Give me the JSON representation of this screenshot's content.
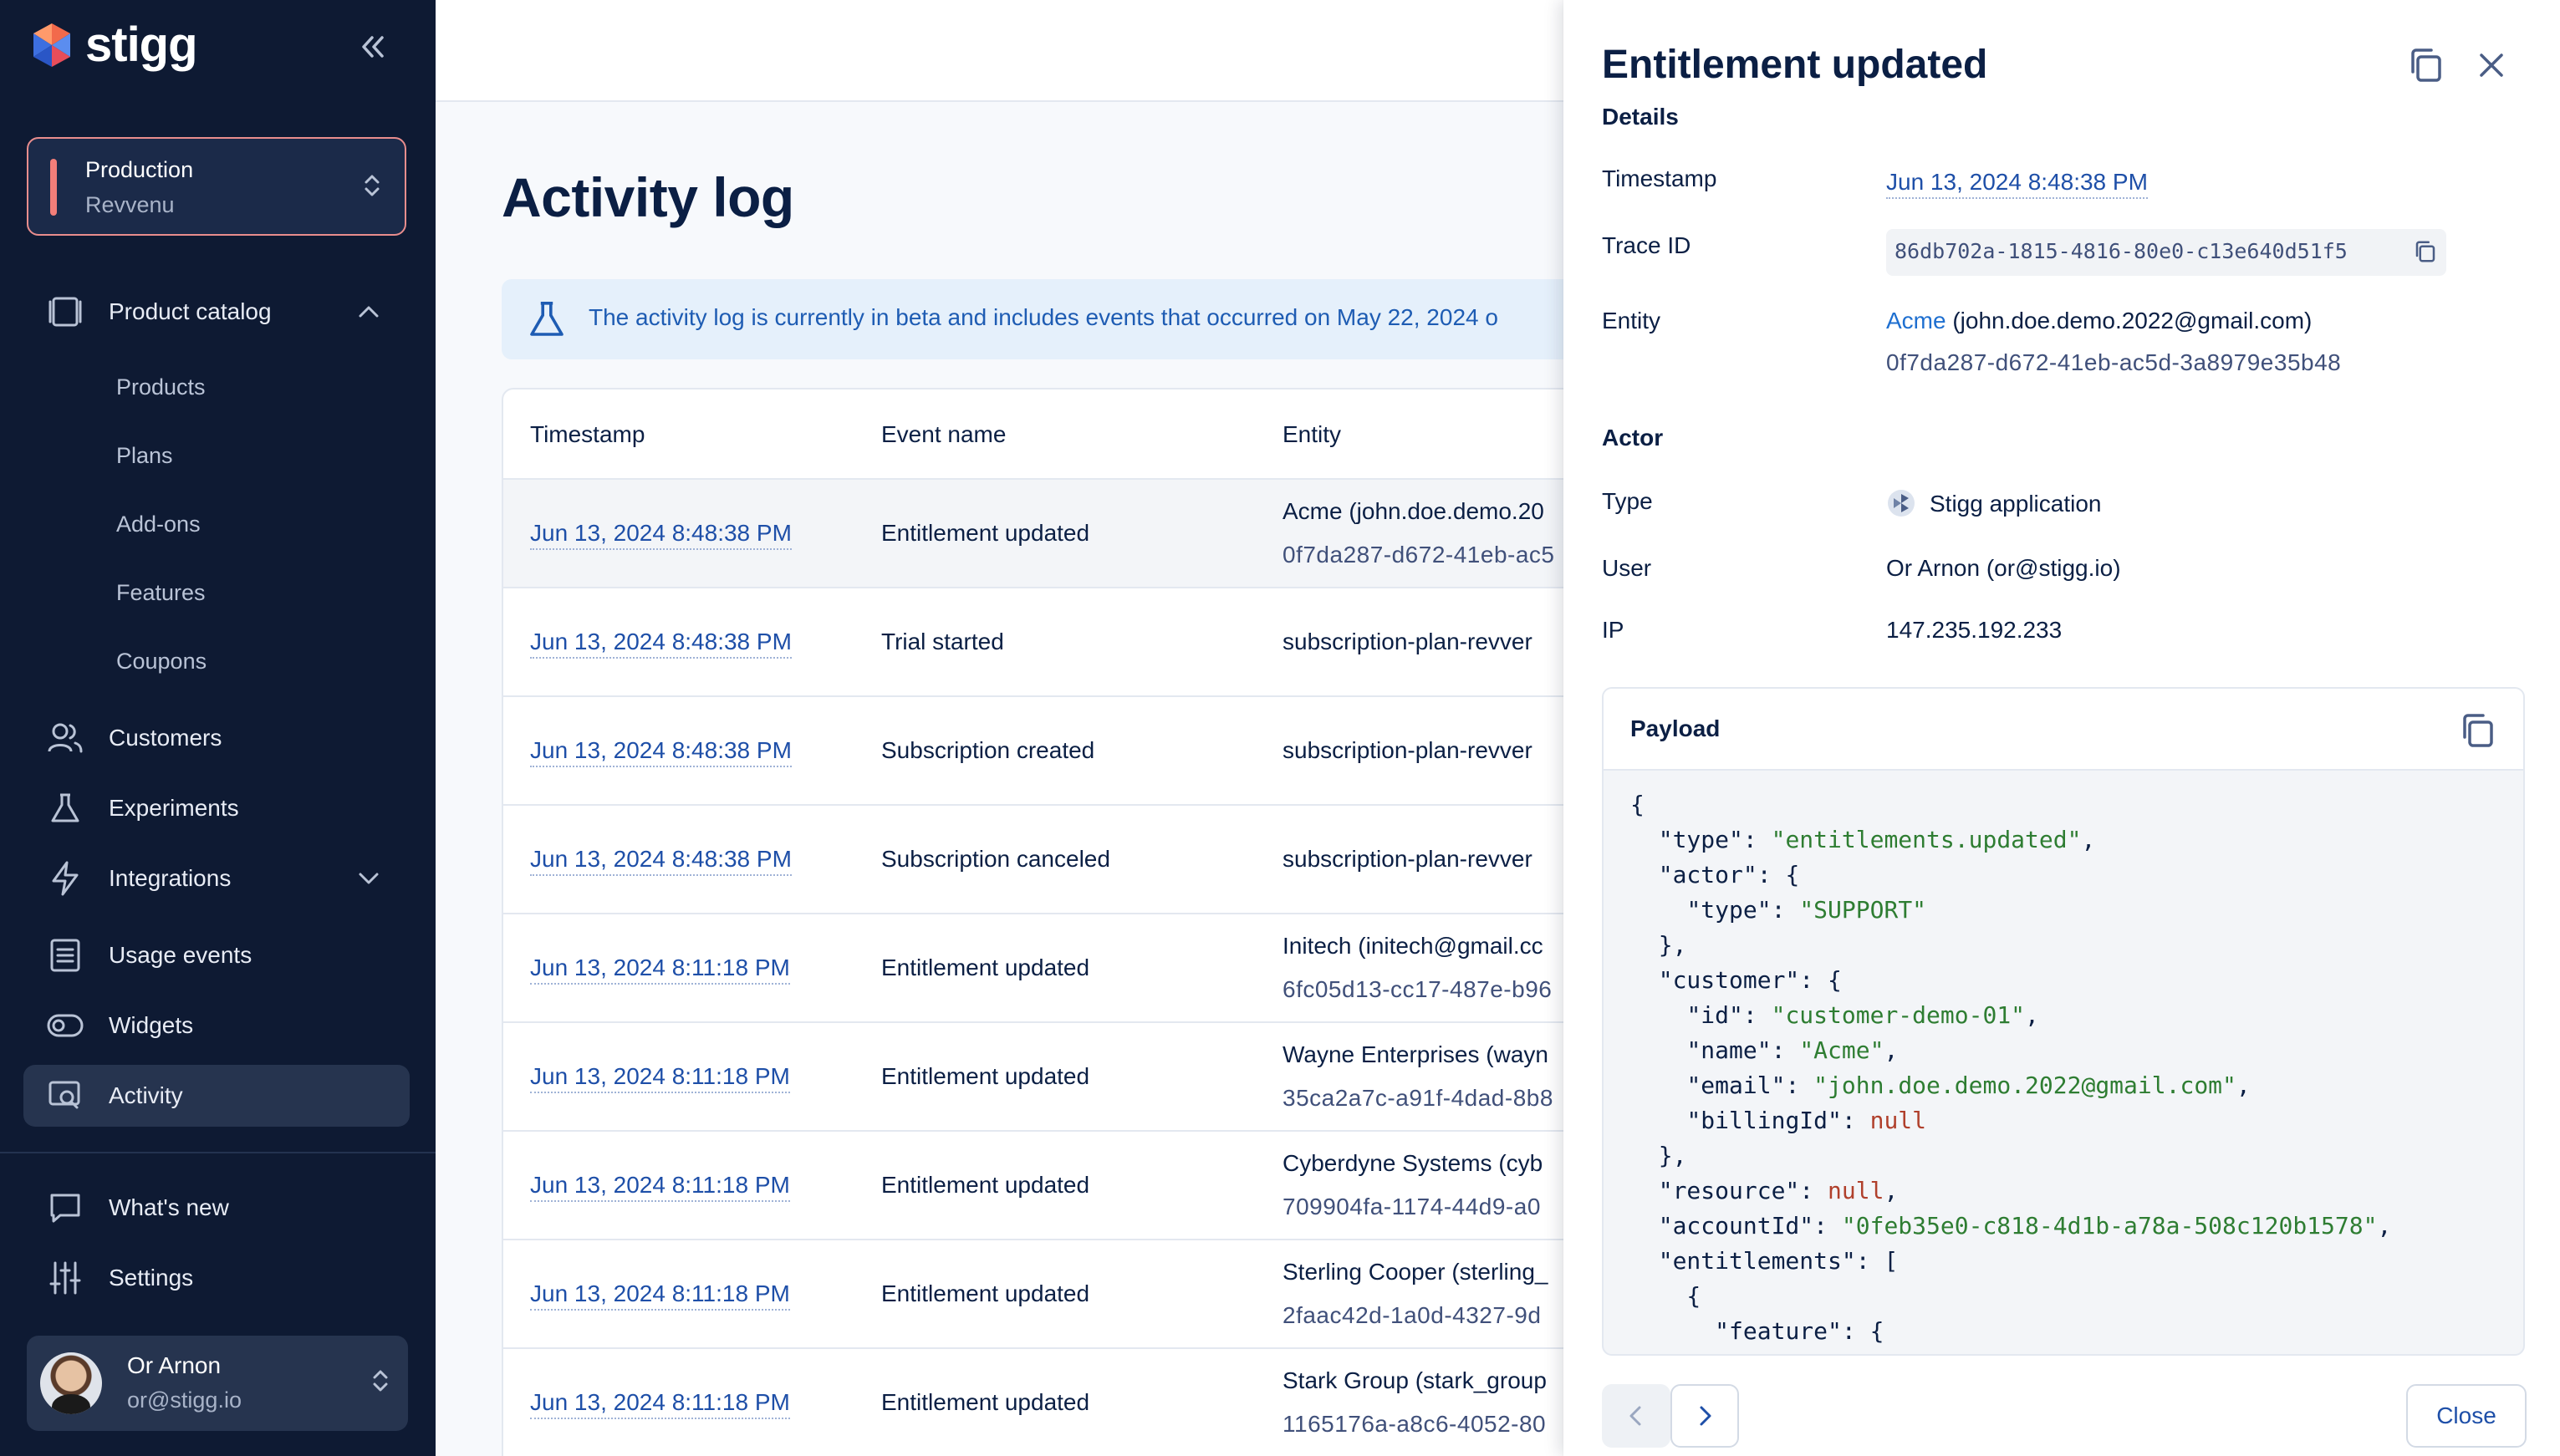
{
  "sidebar": {
    "brand": "stigg",
    "environment": {
      "name": "Production",
      "account": "Revvenu"
    },
    "items": [
      {
        "label": "Product catalog"
      },
      {
        "label": "Customers"
      },
      {
        "label": "Experiments"
      },
      {
        "label": "Integrations"
      },
      {
        "label": "Usage events"
      },
      {
        "label": "Widgets"
      },
      {
        "label": "Activity"
      }
    ],
    "catalog_sub": [
      "Products",
      "Plans",
      "Add-ons",
      "Features",
      "Coupons"
    ],
    "bottom": [
      {
        "label": "What's new"
      },
      {
        "label": "Settings"
      }
    ],
    "user": {
      "name": "Or Arnon",
      "email": "or@stigg.io"
    }
  },
  "main": {
    "title": "Activity log",
    "beta_notice": "The activity log is currently in beta and includes events that occurred on May 22, 2024 o",
    "columns": [
      "Timestamp",
      "Event name",
      "Entity"
    ],
    "rows": [
      {
        "ts": "Jun 13, 2024 8:48:38 PM",
        "event": "Entitlement updated",
        "entity": "Acme (john.doe.demo.20",
        "entity_id": "0f7da287-d672-41eb-ac5"
      },
      {
        "ts": "Jun 13, 2024 8:48:38 PM",
        "event": "Trial started",
        "entity": "subscription-plan-revver",
        "entity_id": ""
      },
      {
        "ts": "Jun 13, 2024 8:48:38 PM",
        "event": "Subscription created",
        "entity": "subscription-plan-revver",
        "entity_id": ""
      },
      {
        "ts": "Jun 13, 2024 8:48:38 PM",
        "event": "Subscription canceled",
        "entity": "subscription-plan-revver",
        "entity_id": ""
      },
      {
        "ts": "Jun 13, 2024 8:11:18 PM",
        "event": "Entitlement updated",
        "entity": "Initech (initech@gmail.cc",
        "entity_id": "6fc05d13-cc17-487e-b96"
      },
      {
        "ts": "Jun 13, 2024 8:11:18 PM",
        "event": "Entitlement updated",
        "entity": "Wayne Enterprises (wayn",
        "entity_id": "35ca2a7c-a91f-4dad-8b8"
      },
      {
        "ts": "Jun 13, 2024 8:11:18 PM",
        "event": "Entitlement updated",
        "entity": "Cyberdyne Systems (cyb",
        "entity_id": "709904fa-1174-44d9-a0"
      },
      {
        "ts": "Jun 13, 2024 8:11:18 PM",
        "event": "Entitlement updated",
        "entity": "Sterling Cooper (sterling_",
        "entity_id": "2faac42d-1a0d-4327-9d"
      },
      {
        "ts": "Jun 13, 2024 8:11:18 PM",
        "event": "Entitlement updated",
        "entity": "Stark Group (stark_group",
        "entity_id": "1165176a-a8c6-4052-80"
      }
    ]
  },
  "panel": {
    "title": "Entitlement updated",
    "details_label": "Details",
    "timestamp_label": "Timestamp",
    "timestamp": "Jun 13, 2024 8:48:38 PM",
    "trace_label": "Trace ID",
    "trace_id": "86db702a-1815-4816-80e0-c13e640d51f5",
    "entity_label": "Entity",
    "entity_name": "Acme",
    "entity_email": "(john.doe.demo.2022@gmail.com)",
    "entity_id": "0f7da287-d672-41eb-ac5d-3a8979e35b48",
    "actor_label": "Actor",
    "type_label": "Type",
    "type_value": "Stigg application",
    "user_label": "User",
    "user_value": "Or Arnon (or@stigg.io)",
    "ip_label": "IP",
    "ip_value": "147.235.192.233",
    "payload_label": "Payload",
    "close_label": "Close"
  },
  "payload_lines": [
    "{",
    "  \"type\": \"entitlements.updated\",",
    "  \"actor\": {",
    "    \"type\": \"SUPPORT\"",
    "  },",
    "  \"customer\": {",
    "    \"id\": \"customer-demo-01\",",
    "    \"name\": \"Acme\",",
    "    \"email\": \"john.doe.demo.2022@gmail.com\",",
    "    \"billingId\": null",
    "  },",
    "  \"resource\": null,",
    "  \"accountId\": \"0feb35e0-c818-4d1b-a78a-508c120b1578\",",
    "  \"entitlements\": [",
    "    {",
    "      \"feature\": {"
  ],
  "colors": {
    "sidebar": "#0e1a33",
    "accent": "#1e4fa8",
    "env_border": "#e98d8d",
    "string": "#2e7d32",
    "null": "#b0402c"
  }
}
